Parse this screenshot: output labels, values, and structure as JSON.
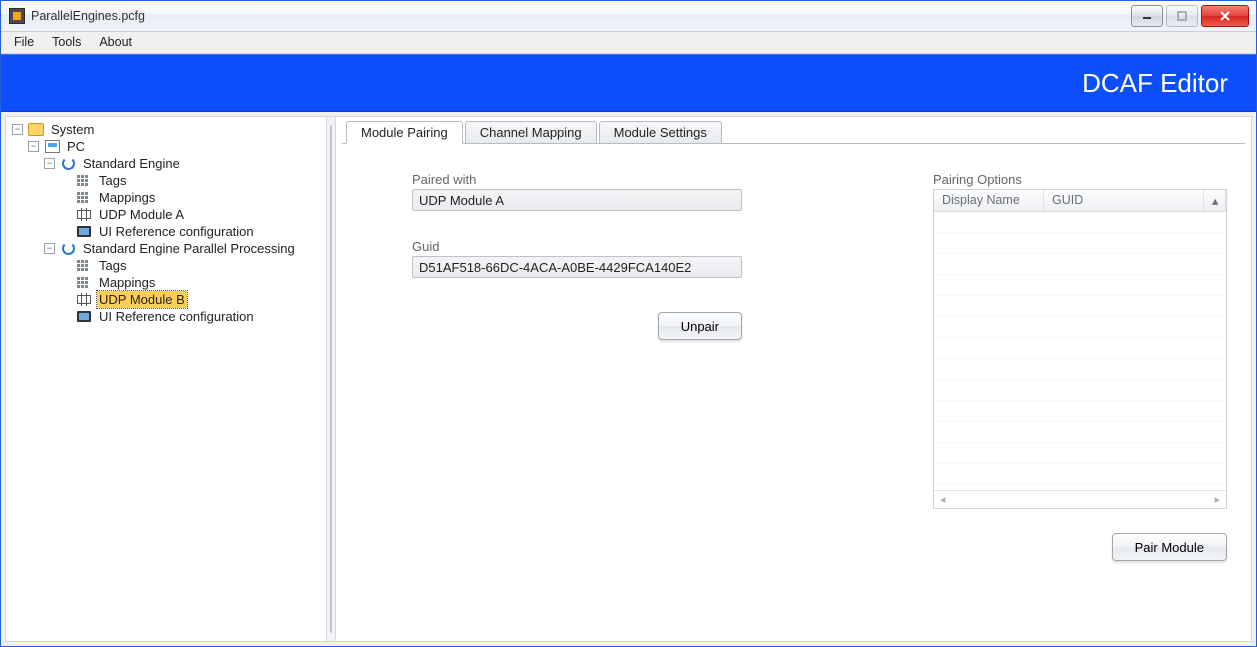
{
  "window": {
    "title": "ParallelEngines.pcfg"
  },
  "menubar": {
    "items": [
      "File",
      "Tools",
      "About"
    ]
  },
  "banner": {
    "title": "DCAF Editor"
  },
  "tree": {
    "root": "System",
    "pc": "PC",
    "engine1": {
      "name": "Standard Engine",
      "children": [
        "Tags",
        "Mappings",
        "UDP Module A",
        "UI Reference configuration"
      ]
    },
    "engine2": {
      "name": "Standard Engine Parallel Processing",
      "children": [
        "Tags",
        "Mappings",
        "UDP Module B",
        "UI Reference configuration"
      ]
    },
    "selected": "UDP Module B"
  },
  "tabs": {
    "items": [
      "Module Pairing",
      "Channel Mapping",
      "Module Settings"
    ],
    "active_index": 0
  },
  "pairing": {
    "paired_with_label": "Paired with",
    "paired_with_value": "UDP Module A",
    "guid_label": "Guid",
    "guid_value": "D51AF518-66DC-4ACA-A0BE-4429FCA140E2",
    "unpair_btn": "Unpair"
  },
  "options": {
    "heading": "Pairing Options",
    "columns": [
      "Display Name",
      "GUID"
    ],
    "pair_btn": "Pair Module"
  },
  "win_controls": {
    "minimize": "minimize",
    "maximize": "maximize",
    "close": "close"
  }
}
